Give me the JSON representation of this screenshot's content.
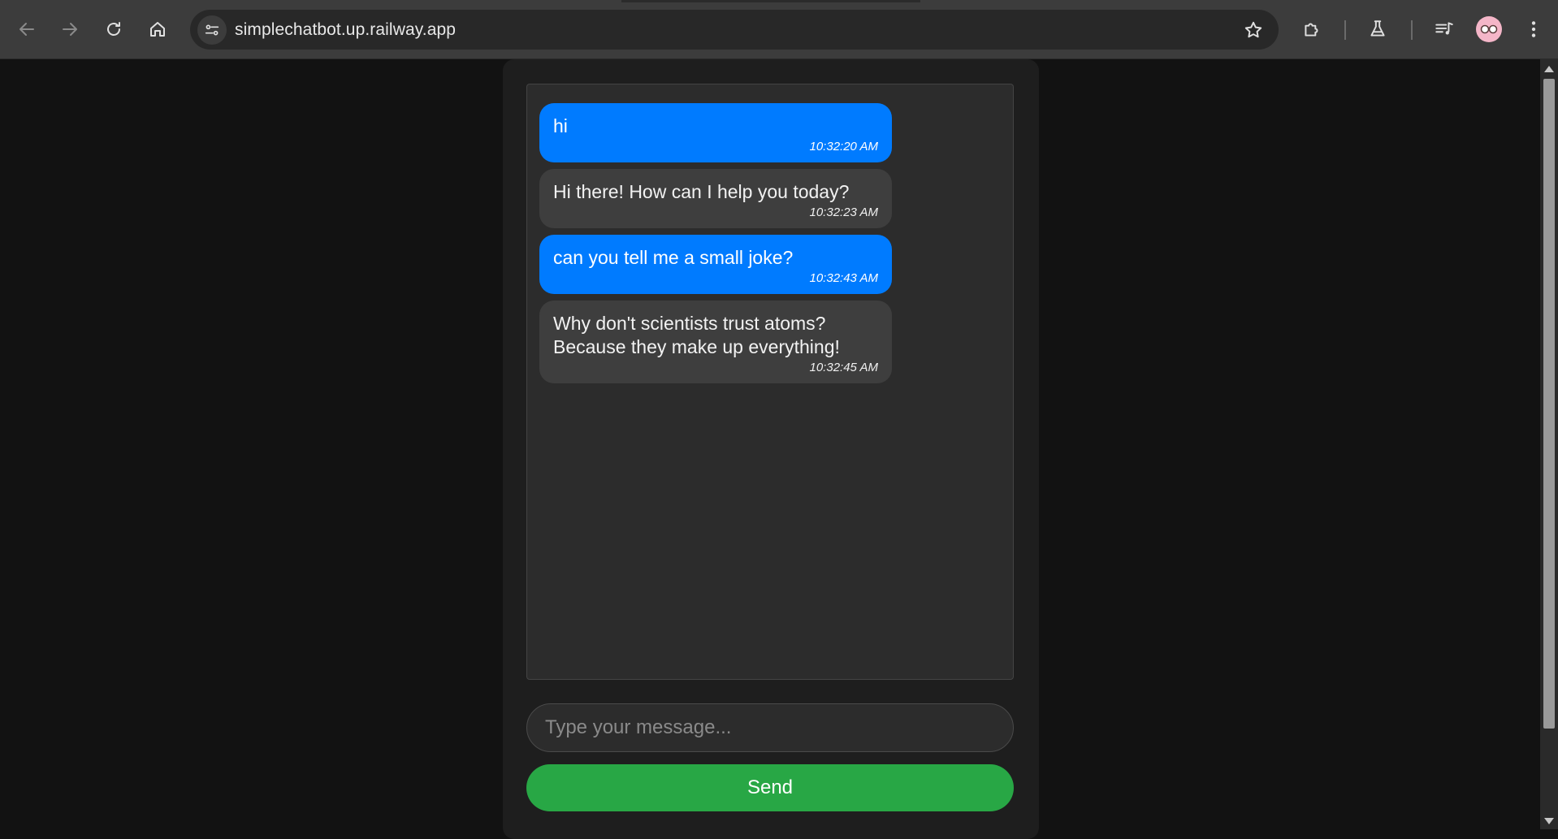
{
  "browser": {
    "url": "simplechatbot.up.railway.app",
    "icons": {
      "back": "back-arrow-icon",
      "forward": "forward-arrow-icon",
      "reload": "reload-icon",
      "home": "home-icon",
      "site_info": "tune-icon",
      "bookmark": "star-icon",
      "extensions": "puzzle-icon",
      "labs": "flask-icon",
      "media": "playlist-icon",
      "profile": "avatar-icon",
      "menu": "kebab-menu-icon"
    }
  },
  "chat": {
    "messages": [
      {
        "sender": "user",
        "text": "hi",
        "time": "10:32:20 AM"
      },
      {
        "sender": "bot",
        "text": "Hi there! How can I help you today?",
        "time": "10:32:23 AM"
      },
      {
        "sender": "user",
        "text": "can you tell me a small joke?",
        "time": "10:32:43 AM"
      },
      {
        "sender": "bot",
        "text": "Why don't scientists trust atoms?\nBecause they make up everything!",
        "time": "10:32:45 AM"
      }
    ],
    "input": {
      "value": "",
      "placeholder": "Type your message..."
    },
    "send_label": "Send"
  },
  "colors": {
    "user_bubble": "#007bff",
    "bot_bubble": "#3e3e3e",
    "send_button": "#28a745",
    "page_background": "#121212"
  }
}
